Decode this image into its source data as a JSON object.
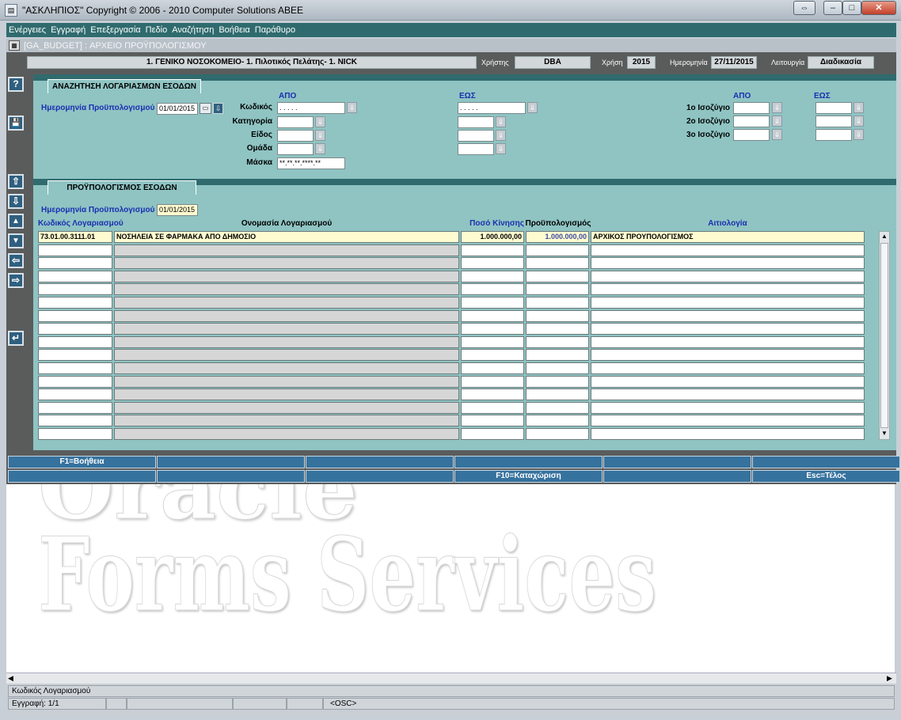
{
  "window": {
    "title": "\"ΑΣΚΛΗΠΙΟΣ\" Copyright © 2006 - 2010 Computer Solutions ABEE",
    "btn_restore": "⇔",
    "btn_min": "–",
    "btn_max": "□",
    "btn_close": "✕"
  },
  "menu": [
    "Ενέργειες",
    "Εγγραφή",
    "Επεξεργασία",
    "Πεδίο",
    "Αναζήτηση",
    "Βοήθεια",
    "Παράθυρο"
  ],
  "form_title": "[GA_BUDGET]  :  ΑΡΧΕΙΟ ΠΡΟΫΠΟΛΟΓΙΣΜΟΥ",
  "header": {
    "org": "1. ΓΕΝΙΚΟ ΝΟΣΟΚΟΜΕΙΟ- 1. Πιλοτικός Πελάτης- 1. NICK",
    "user_label": "Χρήστης",
    "user": "DBA",
    "year_label": "Χρήση",
    "year": "2015",
    "date_label": "Ημερομηνία",
    "date": "27/11/2015",
    "function_label": "Λειτουργία",
    "function": "Διαδικασία"
  },
  "search": {
    "tab": "ΑΝΑΖΗΤΗΣΗ ΛΟΓΑΡΙΑΣΜΩΝ ΕΣΟΔΩΝ",
    "budget_date_label": "Ημερομηνία Προϋπολογισμού",
    "budget_date": "01/01/2015",
    "from": "ΑΠΟ",
    "to": "ΕΩΣ",
    "code_label": "Κωδικός",
    "category_label": "Κατηγορία",
    "type_label": "Είδος",
    "group_label": "Ομάδα",
    "mask_label": "Μάσκα",
    "code_from": " .   .   .   .   .",
    "code_to": " .   .   .   .   .",
    "mask": "**.**.**.****.**",
    "bal_from": "ΑΠΟ",
    "bal_to": "ΕΩΣ",
    "bal1": "1ο Ισοζύγιο",
    "bal2": "2ο Ισοζύγιο",
    "bal3": "3ο Ισοζύγιο"
  },
  "budget": {
    "tab": "ΠΡΟΫΠΟΛΟΓΙΣΜΟΣ ΕΣΟΔΩΝ",
    "budget_date_label": "Ημερομηνία Προϋπολογισμού",
    "budget_date": "01/01/2015",
    "columns": {
      "code": "Κωδικός Λογαριασμού",
      "name": "Ονομασία Λογαριασμού",
      "amount": "Ποσό Κίνησης",
      "budget": "Προϋπολογισμός",
      "reason": "Αιτιολογία"
    },
    "rows": [
      {
        "code": "73.01.00.3111.01",
        "name": "ΝΟΣΗΛΕΙΑ ΣΕ ΦΑΡΜΑΚΑ ΑΠΟ ΔΗΜΟΣΙΟ",
        "amount": "1.000.000,00",
        "budget": "1.000.000,00",
        "reason": "ΑΡΧΙΚΟΣ ΠΡΟΥΠΟΛΟΓΙΣΜΟΣ"
      }
    ],
    "empty_rows": 15
  },
  "toolbar": {
    "help": "?",
    "save": "💾",
    "up": "⇧",
    "down": "⇩",
    "prev_block": "▲",
    "next_block": "▼",
    "left": "⇦",
    "right": "⇨",
    "exit": "↵"
  },
  "fkeys_row1": [
    "F1=Βοήθεια",
    "",
    "",
    "",
    "",
    ""
  ],
  "fkeys_row2": [
    "",
    "",
    "",
    "F10=Καταχώριση",
    "",
    "Esc=Τέλος"
  ],
  "watermark": [
    "Oracle",
    "Forms Services"
  ],
  "status": {
    "hint": "Κωδικός Λογαριασμού",
    "record": "Εγγραφή: 1/1",
    "osc": "<OSC>"
  },
  "colors": {
    "teal": "#2f6b6e",
    "panel": "#8fc4c3",
    "label_blue": "#1a2fb0",
    "fkey": "#36729e",
    "highlight": "#fffbd0"
  }
}
